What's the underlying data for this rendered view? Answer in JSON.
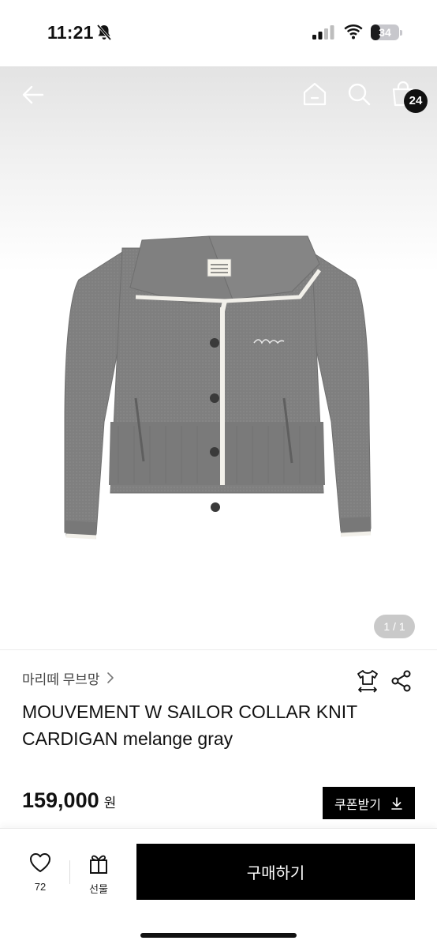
{
  "status_bar": {
    "time": "11:21",
    "battery": "34",
    "battery_level": 0.34
  },
  "top_nav": {
    "icons": [
      "back-arrow-icon",
      "home-icon",
      "search-icon",
      "shopping-bag-icon"
    ],
    "cart_count": "24"
  },
  "gallery": {
    "counter": "1 / 1",
    "image": "gray knit cardigan with white-trimmed sailor collar"
  },
  "product": {
    "brand": "마리떼 무브망",
    "title": "MOUVEMENT W SAILOR COLLAR KNIT CARDIGAN melange gray",
    "price": "159,000",
    "currency": "원",
    "coupon_label": "쿠폰받기"
  },
  "bottom_bar": {
    "like_count": "72",
    "gift_label": "선물",
    "buy_label": "구매하기"
  },
  "colors": {
    "primary": "#000000",
    "background": "#ffffff",
    "sweater": "#7d7d7d",
    "trim": "#f2f0ea"
  }
}
